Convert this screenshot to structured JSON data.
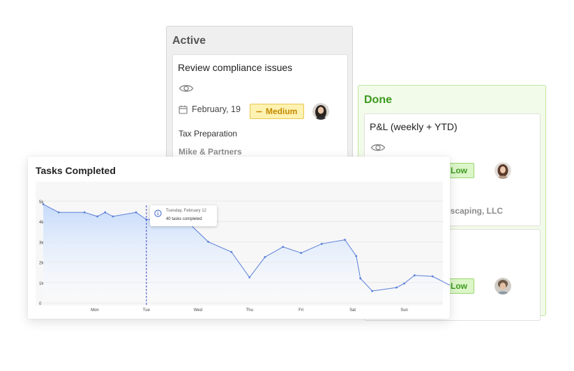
{
  "board": {
    "active_column": {
      "title": "Active",
      "card": {
        "title": "Review compliance issues",
        "date": "February, 19",
        "priority": "Medium",
        "category": "Tax Preparation",
        "client": "Mike & Partners"
      }
    },
    "done_column": {
      "title": "Done",
      "cards": [
        {
          "title": "P&L (weekly + YTD)",
          "priority": "Low",
          "client": "ndscaping, LLC"
        },
        {
          "title": "",
          "priority": "Low"
        }
      ]
    }
  },
  "colors": {
    "done_accent": "#3c9a1e",
    "medium_badge": "#fdf2b2",
    "low_badge": "#dcf6c9",
    "line": "#5a7fd6",
    "area": "#c3d9fb",
    "hover_line": "#4a57c8"
  },
  "icons": {
    "eye": "eye-icon",
    "calendar": "calendar-icon",
    "medium_priority": "minus-icon",
    "low_priority": "arrow-down-icon",
    "tooltip": "info-icon"
  },
  "chart_data": {
    "type": "area",
    "title": "Tasks Completed",
    "xlabel": "",
    "ylabel": "",
    "ylim": [
      0,
      5000
    ],
    "yticks": [
      0,
      1000,
      2000,
      3000,
      4000,
      5000
    ],
    "ytick_labels": [
      "0",
      "1k",
      "2k",
      "3k",
      "4k",
      "5k"
    ],
    "xtick_labels": [
      "Mon",
      "Tue",
      "Wed",
      "Thu",
      "Fri",
      "Sat",
      "Sun"
    ],
    "grid": true,
    "legend": "none",
    "x_range": [
      -1,
      6.75
    ],
    "x": [
      -1,
      -0.7,
      -0.2,
      0.05,
      0.2,
      0.35,
      0.8,
      1.0,
      1.35,
      1.5,
      1.75,
      2.2,
      2.65,
      3.0,
      3.3,
      3.65,
      4.0,
      4.4,
      4.85,
      5.07,
      5.15,
      5.38,
      5.85,
      6.0,
      6.2,
      6.55
    ],
    "values": [
      4850,
      4450,
      4450,
      4250,
      4450,
      4250,
      4450,
      4100,
      4100,
      4100,
      4100,
      3000,
      2500,
      1250,
      2250,
      2750,
      2450,
      2900,
      3100,
      2300,
      1200,
      580,
      750,
      950,
      1350,
      1300
    ],
    "series_end": [
      6.9,
      850
    ],
    "hover": {
      "x": 1.0,
      "date": "Tuesday, February 12",
      "text": "40 tasks completed"
    }
  }
}
